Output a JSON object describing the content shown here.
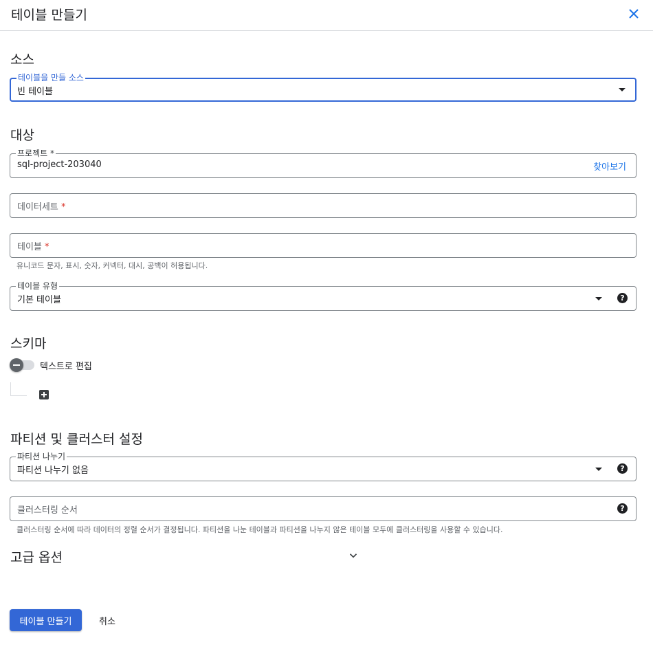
{
  "header": {
    "title": "테이블 만들기",
    "close_icon": "close-icon",
    "accent": "#1a73e8"
  },
  "source": {
    "section_title": "소스",
    "source_field": {
      "label": "테이블을 만들 소스",
      "value": "빈 테이블"
    }
  },
  "destination": {
    "section_title": "대상",
    "project": {
      "label": "프로젝트 *",
      "value": "sql-project-203040",
      "browse_label": "찾아보기"
    },
    "dataset": {
      "placeholder": "데이터세트",
      "required_mark": "*"
    },
    "table": {
      "placeholder": "테이블",
      "required_mark": "*",
      "hint": "유니코드 문자, 표시, 숫자, 커넥터, 대시, 공백이 허용됩니다."
    },
    "table_type": {
      "label": "테이블 유형",
      "value": "기본 테이블",
      "help": "?"
    }
  },
  "schema": {
    "section_title": "스키마",
    "toggle_label": "텍스트로 편집"
  },
  "partition": {
    "section_title": "파티션 및 클러스터 설정",
    "partitioning": {
      "label": "파티션 나누기",
      "value": "파티션 나누기 없음",
      "help": "?"
    },
    "clustering": {
      "placeholder": "클러스터링 순서",
      "help": "?",
      "hint": "클러스터링 순서에 따라 데이터의 정렬 순서가 결정됩니다. 파티션을 나눈 테이블과 파티션을 나누지 않은 테이블 모두에 클러스터링을 사용할 수 있습니다."
    }
  },
  "advanced": {
    "section_title": "고급 옵션"
  },
  "footer": {
    "create_label": "테이블 만들기",
    "cancel_label": "취소",
    "primary_color": "#3367d6"
  }
}
